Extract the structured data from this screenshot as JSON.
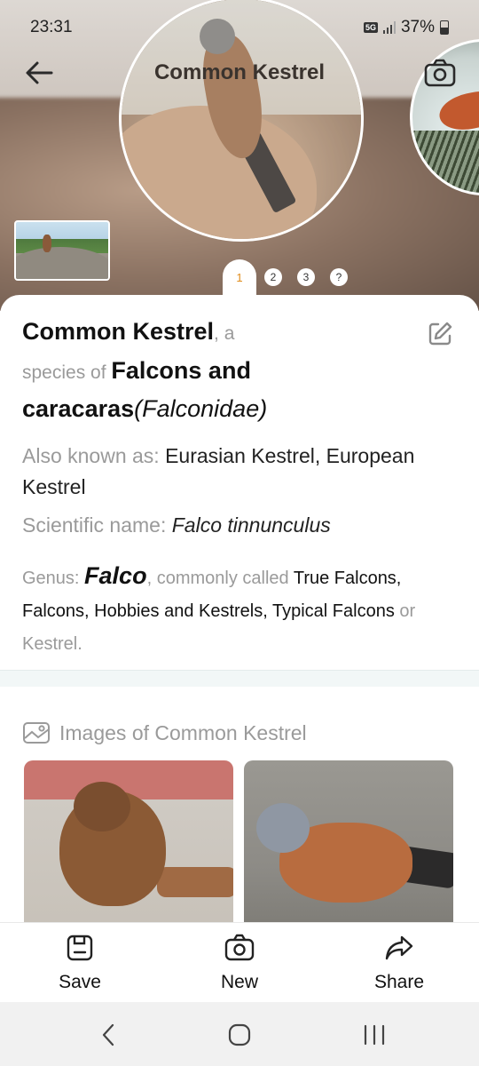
{
  "status_bar": {
    "time": "23:31",
    "network": "5G",
    "battery": "37%"
  },
  "header": {
    "title": "Common Kestrel",
    "back_icon": "arrow-left-icon",
    "camera_icon": "camera-icon"
  },
  "pager": {
    "pages": [
      "1",
      "2",
      "3",
      "?"
    ],
    "active_index": 0,
    "active_color": "#e08c1a"
  },
  "species": {
    "name": "Common Kestrel",
    "connector_a": ", a",
    "connector_species_of": "species of",
    "family_common": "Falcons and",
    "family_common_2": "caracaras",
    "family_scientific": "(Falconidae)",
    "also_known_label": "Also known as:",
    "also_known_value": "Eurasian Kestrel, European Kestrel",
    "scientific_label": "Scientific name:",
    "scientific_value": "Falco tinnunculus",
    "genus_label": "Genus:",
    "genus_value": "Falco",
    "commonly_called_label": ", commonly called",
    "commonly_called_value": "True Falcons, Falcons, Hobbies and Kestrels, Typical Falcons",
    "or_label": "or",
    "or_value": "Kestrel."
  },
  "images_section": {
    "title": "Images of Common Kestrel",
    "icon": "image-icon"
  },
  "actions": [
    {
      "label": "Save",
      "icon": "save-icon"
    },
    {
      "label": "New",
      "icon": "camera-icon"
    },
    {
      "label": "Share",
      "icon": "share-icon"
    }
  ],
  "nav": {
    "back": "nav-back-icon",
    "home": "nav-home-icon",
    "recents": "nav-recents-icon"
  }
}
